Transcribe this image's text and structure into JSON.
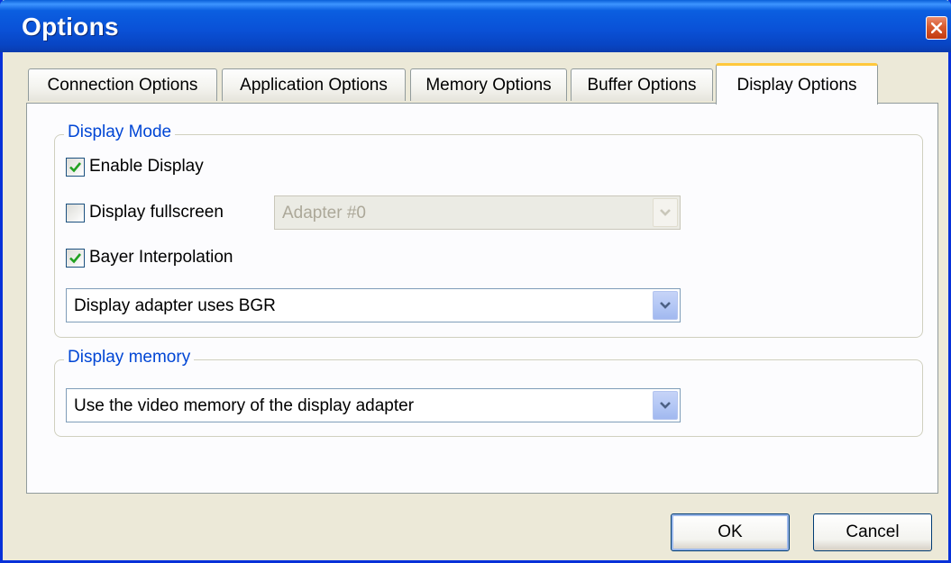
{
  "window": {
    "title": "Options"
  },
  "tabs": [
    {
      "label": "Connection Options"
    },
    {
      "label": "Application Options"
    },
    {
      "label": "Memory Options"
    },
    {
      "label": "Buffer Options"
    },
    {
      "label": "Display Options",
      "active": true
    }
  ],
  "display_mode": {
    "legend": "Display Mode",
    "enable_display": {
      "label": "Enable Display",
      "checked": true
    },
    "display_fullscreen": {
      "label": "Display fullscreen",
      "checked": false
    },
    "adapter_select": {
      "value": "Adapter #0",
      "enabled": false
    },
    "bayer_interpolation": {
      "label": "Bayer Interpolation",
      "checked": true
    },
    "color_order_select": {
      "value": "Display adapter uses BGR"
    }
  },
  "display_memory": {
    "legend": "Display memory",
    "memory_select": {
      "value": "Use the video memory of the display adapter"
    }
  },
  "buttons": {
    "ok": "OK",
    "cancel": "Cancel"
  },
  "colors": {
    "titlebar": "#0a52d8",
    "legend_text": "#0046d5",
    "active_tab_accent": "#ffc83c",
    "checkmark": "#21a121"
  },
  "icons": {
    "close": "close-icon",
    "check": "checkmark-icon",
    "dropdown": "chevron-down-icon"
  }
}
